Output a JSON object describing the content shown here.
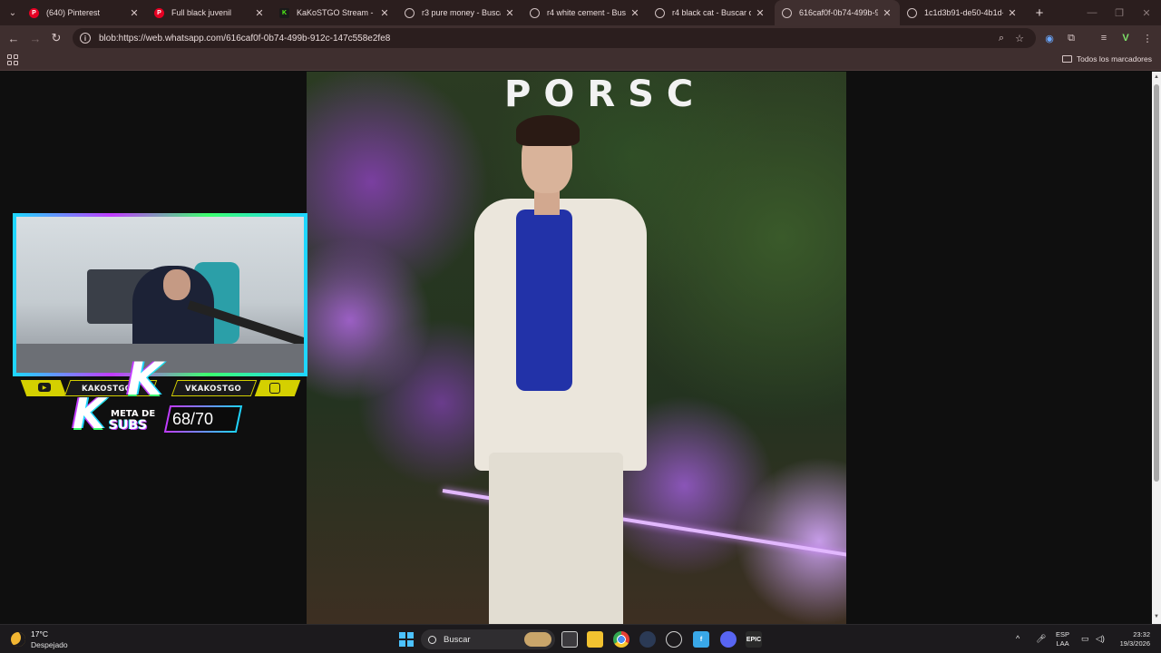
{
  "browser": {
    "tabs": [
      {
        "title": "(640) Pinterest",
        "favicon": "pinterest-icon"
      },
      {
        "title": "Full black juvenil",
        "favicon": "pinterest-icon"
      },
      {
        "title": "KaKoSTGO Stream - Watc",
        "favicon": "kick-icon"
      },
      {
        "title": "r3 pure money - Buscar c",
        "favicon": "google-icon"
      },
      {
        "title": "r4 white cement - Buscar",
        "favicon": "google-icon"
      },
      {
        "title": "r4 black cat - Buscar con",
        "favicon": "google-icon"
      },
      {
        "title": "616caf0f-0b74-499b-912c",
        "favicon": "globe-icon",
        "active": true
      },
      {
        "title": "1c1d3b91-de50-4b1d-ae",
        "favicon": "globe-icon"
      }
    ],
    "url": "blob:https://web.whatsapp.com/616caf0f-0b74-499b-912c-147c558e2fe8",
    "bookmarks": {
      "all_label": "Todos los marcadores"
    }
  },
  "viewer": {
    "photo_sign": "PORSC"
  },
  "stream_overlay": {
    "youtube_handle": "KAKOSTGO",
    "instagram_handle": "VKAKOSTGO",
    "logo_letter": "K",
    "goal_line1": "META DE",
    "goal_line2": "SUBS",
    "goal_count": "68/70",
    "accent_colors": [
      "#1fd6ff",
      "#c23cff",
      "#3cff6e",
      "#d4d000"
    ]
  },
  "taskbar": {
    "weather_temp": "17°C",
    "weather_desc": "Despejado",
    "search_label": "Buscar",
    "lang_line1": "ESP",
    "lang_line2": "LAA",
    "time": "23:32",
    "date": "19/3/2026",
    "apps": [
      "task-view-icon",
      "file-explorer-icon",
      "chrome-icon",
      "app-icon",
      "steam-icon",
      "fiverr-icon",
      "discord-icon",
      "epic-games-icon"
    ]
  }
}
